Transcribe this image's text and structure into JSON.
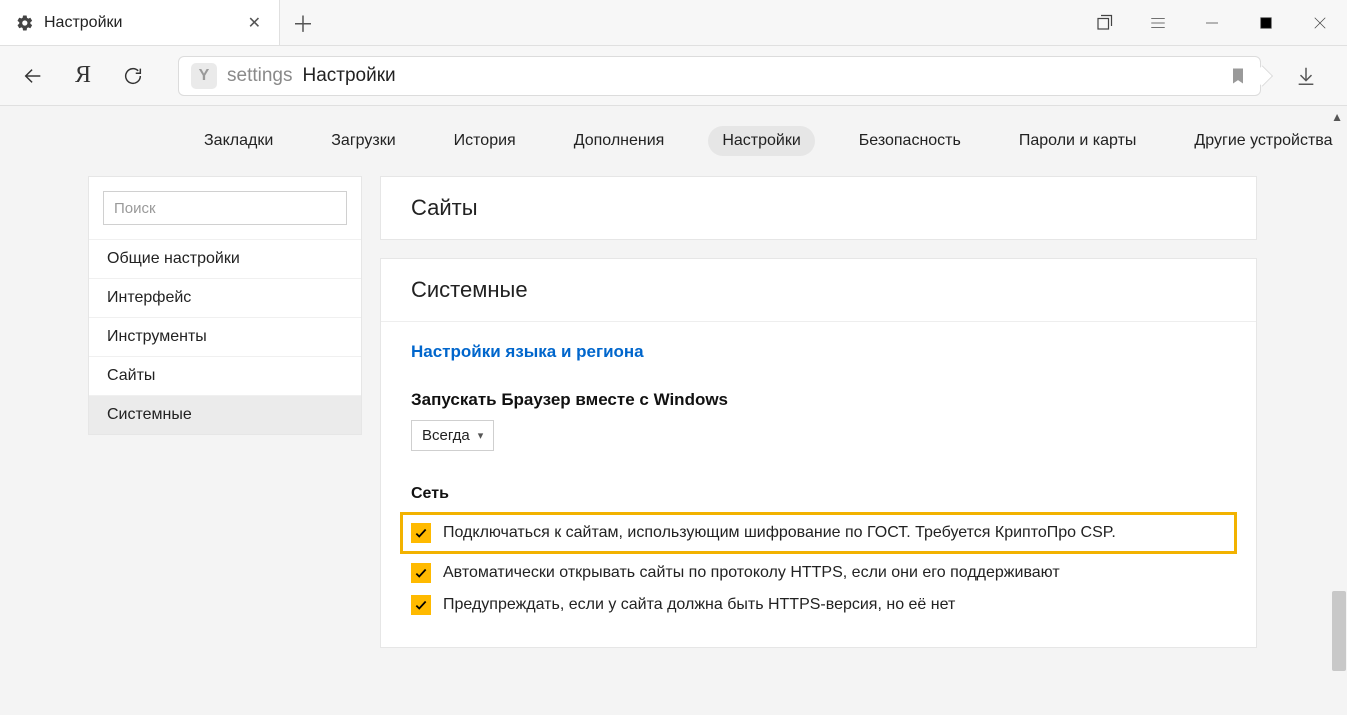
{
  "tab": {
    "title": "Настройки"
  },
  "address": {
    "prefix": "settings",
    "title": "Настройки"
  },
  "topnav": {
    "items": [
      "Закладки",
      "Загрузки",
      "История",
      "Дополнения",
      "Настройки",
      "Безопасность",
      "Пароли и карты",
      "Другие устройства"
    ],
    "activeIndex": 4
  },
  "sidebar": {
    "search_placeholder": "Поиск",
    "items": [
      "Общие настройки",
      "Интерфейс",
      "Инструменты",
      "Сайты",
      "Системные"
    ],
    "activeIndex": 4
  },
  "cards": {
    "sites": {
      "title": "Сайты"
    },
    "system": {
      "title": "Системные",
      "lang_link": "Настройки языка и региона",
      "startup_label": "Запускать Браузер вместе с Windows",
      "startup_value": "Всегда",
      "network_header": "Сеть",
      "checks": [
        {
          "label": "Подключаться к сайтам, использующим шифрование по ГОСТ. Требуется КриптоПро CSP.",
          "checked": true,
          "highlight": true
        },
        {
          "label": "Автоматически открывать сайты по протоколу HTTPS, если они его поддерживают",
          "checked": true,
          "highlight": false
        },
        {
          "label": "Предупреждать, если у сайта должна быть HTTPS-версия, но её нет",
          "checked": true,
          "highlight": false
        }
      ]
    }
  }
}
